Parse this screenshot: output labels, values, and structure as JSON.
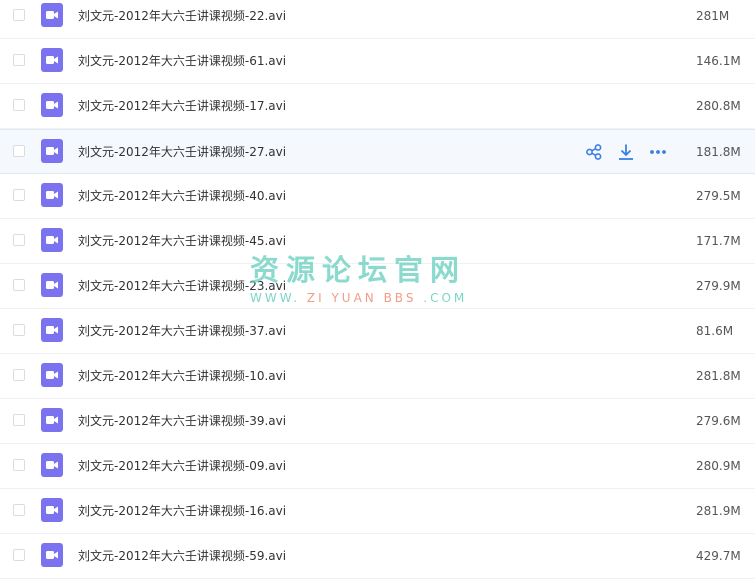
{
  "files": [
    {
      "name": "刘文元-2012年大六壬讲课视频-22.avi",
      "size": "281M"
    },
    {
      "name": "刘文元-2012年大六壬讲课视频-61.avi",
      "size": "146.1M"
    },
    {
      "name": "刘文元-2012年大六壬讲课视频-17.avi",
      "size": "280.8M"
    },
    {
      "name": "刘文元-2012年大六壬讲课视频-27.avi",
      "size": "181.8M"
    },
    {
      "name": "刘文元-2012年大六壬讲课视频-40.avi",
      "size": "279.5M"
    },
    {
      "name": "刘文元-2012年大六壬讲课视频-45.avi",
      "size": "171.7M"
    },
    {
      "name": "刘文元-2012年大六壬讲课视频-23.avi",
      "size": "279.9M"
    },
    {
      "name": "刘文元-2012年大六壬讲课视频-37.avi",
      "size": "81.6M"
    },
    {
      "name": "刘文元-2012年大六壬讲课视频-10.avi",
      "size": "281.8M"
    },
    {
      "name": "刘文元-2012年大六壬讲课视频-39.avi",
      "size": "279.6M"
    },
    {
      "name": "刘文元-2012年大六壬讲课视频-09.avi",
      "size": "280.9M"
    },
    {
      "name": "刘文元-2012年大六壬讲课视频-16.avi",
      "size": "281.9M"
    },
    {
      "name": "刘文元-2012年大六壬讲课视频-59.avi",
      "size": "429.7M"
    }
  ],
  "hovered_row": 3,
  "hover_actions": [
    {
      "icon": "share-icon"
    },
    {
      "icon": "download-icon"
    },
    {
      "icon": "more-icon"
    }
  ],
  "colors": {
    "video_icon": "#7b72f0",
    "action_icon": "#3b7fe0",
    "hover_row_bg": "#f5f8fd"
  },
  "watermark": {
    "title": "资源论坛官网",
    "url_part1": "WWW.",
    "url_part2": "ZI YUAN BBS",
    "url_part3": ".COM"
  }
}
